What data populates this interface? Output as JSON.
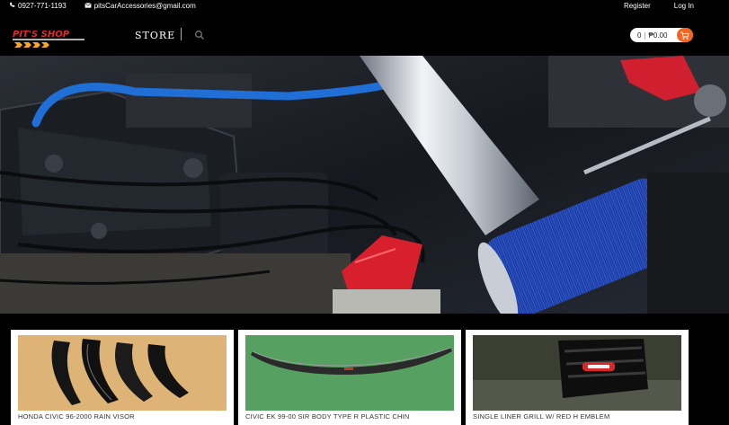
{
  "topbar": {
    "phone": "0927-771-1193",
    "email": "pitsCarAccessories@gmail.com",
    "register": "Register",
    "login": "Log In"
  },
  "header": {
    "logo_text": "PIT'S SHOP",
    "nav_store": "STORE",
    "cart_count": "0",
    "cart_total": "₱0.00"
  },
  "hero": {
    "slides": 3,
    "active_slide": 2
  },
  "products": [
    {
      "name": "HONDA CIVIC 96-2000 RAIN VISOR"
    },
    {
      "name": "CIVIC EK 99-00 SIR BODY TYPE R PLASTIC CHIN"
    },
    {
      "name": "SINGLE LINER GRILL W/ RED H EMBLEM"
    }
  ],
  "colors": {
    "accent": "#f26522",
    "background": "#000000"
  }
}
